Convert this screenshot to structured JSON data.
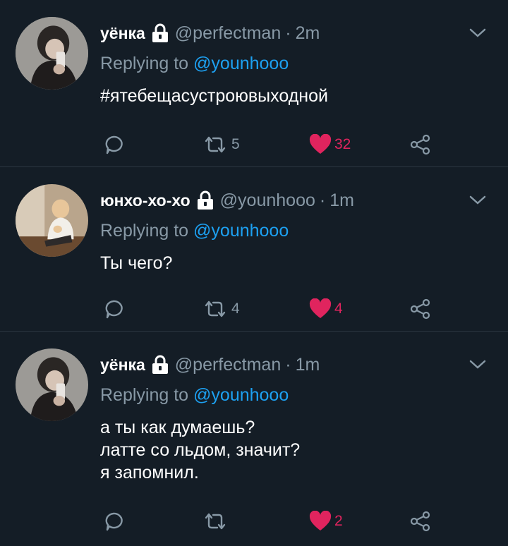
{
  "colors": {
    "background": "#141d26",
    "muted": "#8899a6",
    "link": "#1da1f2",
    "like": "#e0245e",
    "divider": "#2b3640"
  },
  "tweets": [
    {
      "name": "уёнка",
      "handle": "@perfectman",
      "separator": "·",
      "time": "2m",
      "replying_prefix": "Replying to ",
      "replying_to": "@younhooo",
      "text": "#ятебещасустроювыходной",
      "retweets": "5",
      "likes": "32",
      "liked": true
    },
    {
      "name": "юнхо-хо-хо",
      "handle": "@younhooo",
      "separator": "·",
      "time": "1m",
      "replying_prefix": "Replying to ",
      "replying_to": "@younhooo",
      "text": "Ты чего?",
      "retweets": "4",
      "likes": "4",
      "liked": true
    },
    {
      "name": "уёнка",
      "handle": "@perfectman",
      "separator": "·",
      "time": "1m",
      "replying_prefix": "Replying to ",
      "replying_to": "@younhooo",
      "text": "а ты как думаешь?\nлатте со льдом, значит?\nя запомнил.",
      "retweets": "",
      "likes": "2",
      "liked": true
    }
  ],
  "icons": {
    "protected": "lock-icon",
    "menu": "chevron-down-icon",
    "reply": "reply-bubble-icon",
    "retweet": "retweet-icon",
    "like": "heart-icon",
    "share": "share-icon"
  }
}
